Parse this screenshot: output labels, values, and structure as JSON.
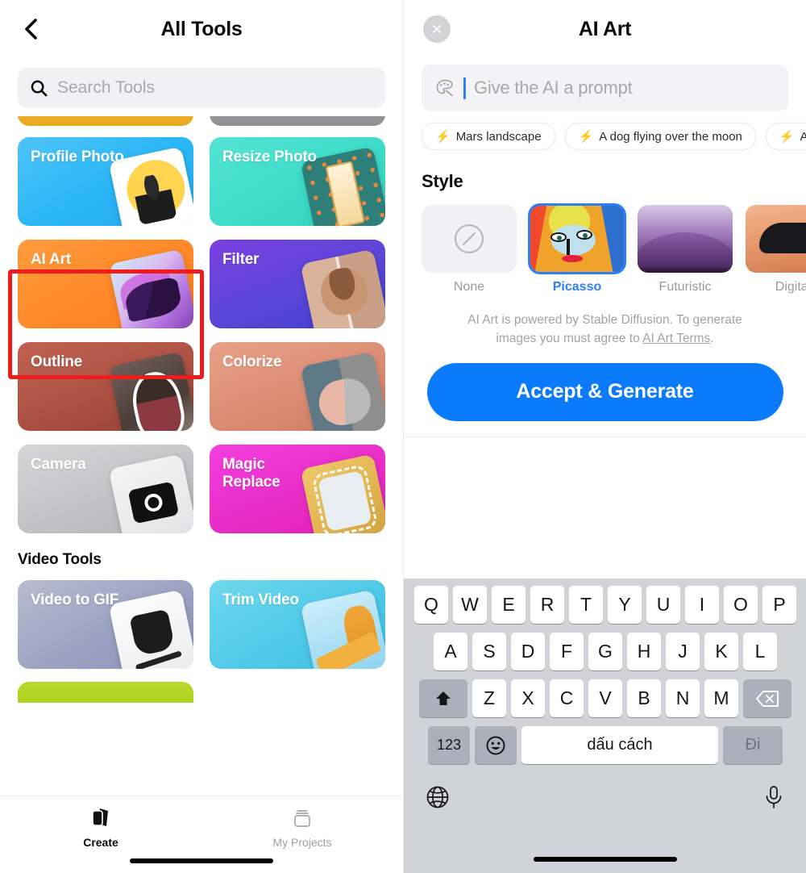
{
  "left": {
    "header": {
      "title": "All Tools",
      "back_icon": "chevron-left-icon"
    },
    "search": {
      "placeholder": "Search Tools",
      "icon": "search-icon"
    },
    "tools": [
      {
        "label": "Profile Photo"
      },
      {
        "label": "Resize Photo"
      },
      {
        "label": "AI Art"
      },
      {
        "label": "Filter"
      },
      {
        "label": "Outline"
      },
      {
        "label": "Colorize"
      },
      {
        "label": "Camera"
      },
      {
        "label": "Magic\nReplace"
      }
    ],
    "tools_flat": {
      "profile_photo": "Profile Photo",
      "resize_photo": "Resize Photo",
      "ai_art": "AI Art",
      "filter": "Filter",
      "outline": "Outline",
      "colorize": "Colorize",
      "camera": "Camera",
      "magic_replace_line1": "Magic",
      "magic_replace_line2": "Replace"
    },
    "video_section": {
      "title": "Video Tools",
      "video_to_gif": "Video to GIF",
      "trim_video": "Trim Video"
    },
    "tabbar": {
      "create": "Create",
      "my_projects": "My Projects",
      "create_icon": "cards-stack-icon",
      "projects_icon": "projects-folder-icon"
    }
  },
  "right": {
    "header": {
      "title": "AI Art",
      "close_icon": "close-circle-icon"
    },
    "prompt": {
      "placeholder": "Give the AI a prompt",
      "icon": "palette-brush-icon",
      "value": ""
    },
    "suggestions": [
      {
        "label": "Mars landscape"
      },
      {
        "label": "A dog flying over the moon"
      },
      {
        "label": "An"
      }
    ],
    "style": {
      "title": "Style",
      "items": [
        {
          "label": "None",
          "selected": false
        },
        {
          "label": "Picasso",
          "selected": true
        },
        {
          "label": "Futuristic",
          "selected": false
        },
        {
          "label": "Digital",
          "selected": false
        }
      ]
    },
    "disclaimer": {
      "text_before": "AI Art is powered by Stable Diffusion. To generate images you must agree to ",
      "link": "AI Art Terms",
      "text_after": "."
    },
    "generate_button": "Accept & Generate"
  },
  "keyboard": {
    "row1": [
      "Q",
      "W",
      "E",
      "R",
      "T",
      "Y",
      "U",
      "I",
      "O",
      "P"
    ],
    "row2": [
      "A",
      "S",
      "D",
      "F",
      "G",
      "H",
      "J",
      "K",
      "L"
    ],
    "row3": [
      "Z",
      "X",
      "C",
      "V",
      "B",
      "N",
      "M"
    ],
    "shift_icon": "shift-arrow-icon",
    "backspace_icon": "backspace-icon",
    "numbers_key": "123",
    "emoji_icon": "emoji-smiley-icon",
    "space_key": "dấu cách",
    "go_key": "Đi",
    "globe_icon": "globe-icon",
    "mic_icon": "microphone-icon"
  },
  "colors": {
    "highlight": "#ee1c1c",
    "accent_blue": "#0b7bfb",
    "selected_blue": "#2d7ff9"
  }
}
